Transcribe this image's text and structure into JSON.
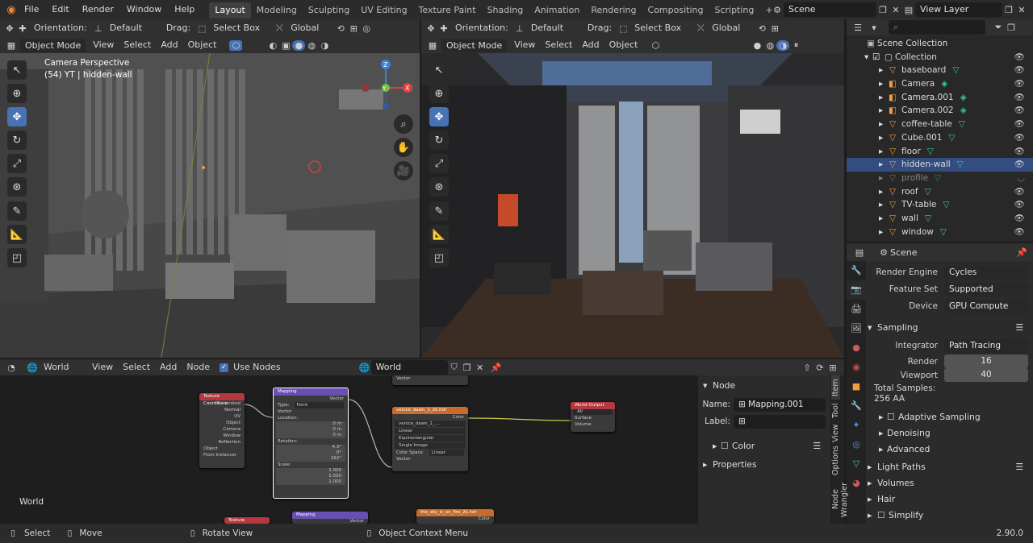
{
  "menubar": {
    "menus": [
      "File",
      "Edit",
      "Render",
      "Window",
      "Help"
    ],
    "workspaces": [
      "Layout",
      "Modeling",
      "Sculpting",
      "UV Editing",
      "Texture Paint",
      "Shading",
      "Animation",
      "Rendering",
      "Compositing",
      "Scripting"
    ],
    "active_workspace": "Layout",
    "add_tab": "+",
    "scene": "Scene",
    "view_layer": "View Layer"
  },
  "viewport_toolbar": {
    "orientation_label": "Orientation:",
    "orientation_value": "Default",
    "drag_label": "Drag:",
    "drag_value": "Select Box",
    "transform_value": "Global"
  },
  "viewport_left": {
    "mode": "Object Mode",
    "menus": [
      "View",
      "Select",
      "Add",
      "Object"
    ],
    "overlay_title": "Camera Perspective",
    "overlay_sub": "(54) YT | hidden-wall",
    "gizmo_x": "X",
    "gizmo_y": "Y",
    "gizmo_z": "Z"
  },
  "viewport_right": {
    "mode": "Object Mode",
    "menus": [
      "View",
      "Select",
      "Add",
      "Object"
    ]
  },
  "outliner": {
    "title": "Scene Collection",
    "collection": "Collection",
    "items": [
      {
        "name": "baseboard",
        "selected": false,
        "dim": false
      },
      {
        "name": "Camera",
        "selected": false,
        "dim": false
      },
      {
        "name": "Camera.001",
        "selected": false,
        "dim": false
      },
      {
        "name": "Camera.002",
        "selected": false,
        "dim": false
      },
      {
        "name": "coffee-table",
        "selected": false,
        "dim": false
      },
      {
        "name": "Cube.001",
        "selected": false,
        "dim": false
      },
      {
        "name": "floor",
        "selected": false,
        "dim": false
      },
      {
        "name": "hidden-wall",
        "selected": true,
        "dim": false
      },
      {
        "name": "profile",
        "selected": false,
        "dim": true
      },
      {
        "name": "roof",
        "selected": false,
        "dim": false
      },
      {
        "name": "TV-table",
        "selected": false,
        "dim": false
      },
      {
        "name": "wall",
        "selected": false,
        "dim": false
      },
      {
        "name": "window",
        "selected": false,
        "dim": false
      }
    ]
  },
  "properties": {
    "context": "Scene",
    "render_engine_label": "Render Engine",
    "render_engine": "Cycles",
    "feature_set_label": "Feature Set",
    "feature_set": "Supported",
    "device_label": "Device",
    "device": "GPU Compute",
    "sampling": "Sampling",
    "integrator_label": "Integrator",
    "integrator": "Path Tracing",
    "render_label": "Render",
    "render_samples": "16",
    "viewport_label": "Viewport",
    "viewport_samples": "40",
    "total_samples_label": "Total Samples:",
    "total_samples": "256 AA",
    "adaptive_sampling": "Adaptive Sampling",
    "denoising": "Denoising",
    "advanced": "Advanced",
    "light_paths": "Light Paths",
    "volumes": "Volumes",
    "hair": "Hair",
    "simplify": "Simplify"
  },
  "node_editor": {
    "editor_type": "World",
    "menus": [
      "View",
      "Select",
      "Add",
      "Node"
    ],
    "use_nodes": "Use Nodes",
    "world_name": "World",
    "label_world": "World",
    "sidebar_tabs": [
      "Item",
      "Tool",
      "View",
      "Options",
      "Node Wrangler"
    ],
    "side_panel": {
      "node_header": "Node",
      "name_label": "Name:",
      "name_value": "Mapping.001",
      "label_label": "Label:",
      "color": "Color",
      "properties": "Properties"
    },
    "nodes": {
      "tex_coord": {
        "title": "Texture Coordinate",
        "outputs": [
          "Generated",
          "Normal",
          "UV",
          "Object",
          "Camera",
          "Window",
          "Reflection"
        ],
        "object_label": "Object",
        "from_instancer": "From Instancer"
      },
      "mapping": {
        "title": "Mapping",
        "vector_out": "Vector",
        "type_label": "Type:",
        "type_value": "Point",
        "vector_in": "Vector",
        "location": "Location:",
        "loc": [
          "0 m",
          "0 m",
          "0 m"
        ],
        "rotation": "Rotation:",
        "rot": [
          "4.3°",
          "0°",
          "162°"
        ],
        "scale": "Scale:",
        "scl": [
          "1.000",
          "1.000",
          "1.000"
        ]
      },
      "env_tex": {
        "title": "venice_dawn_1_2k.hdr",
        "color_out": "Color",
        "image": "venice_dawn_1_...",
        "interp": "Linear",
        "proj": "Equirectangular",
        "source": "Single Image",
        "colorspace_label": "Color Space",
        "colorspace": "Linear",
        "vector_in": "Vector"
      },
      "world_out": {
        "title": "World Output",
        "target": "All",
        "surface": "Surface",
        "volume": "Volume"
      },
      "tex_coord2": {
        "title": "Texture Coordinate"
      },
      "mapping2": {
        "title": "Mapping",
        "vector_out": "Vector"
      },
      "env_tex2": {
        "title": "the_sky_is_on_fire_2k.hdr",
        "color_out": "Color"
      },
      "partial_top": {
        "row1": "Vector"
      }
    }
  },
  "statusbar": {
    "select": "Select",
    "move": "Move",
    "rotate_view": "Rotate View",
    "context_menu": "Object Context Menu",
    "version": "2.90.0"
  },
  "colors": {
    "accent": "#4772b3",
    "selection": "#334d80",
    "object_orange": "#f49c3c",
    "modifier_teal": "#39c8a5",
    "node_purple": "#6a4fb3",
    "node_red": "#b3393f",
    "node_orange": "#c96b2b"
  }
}
